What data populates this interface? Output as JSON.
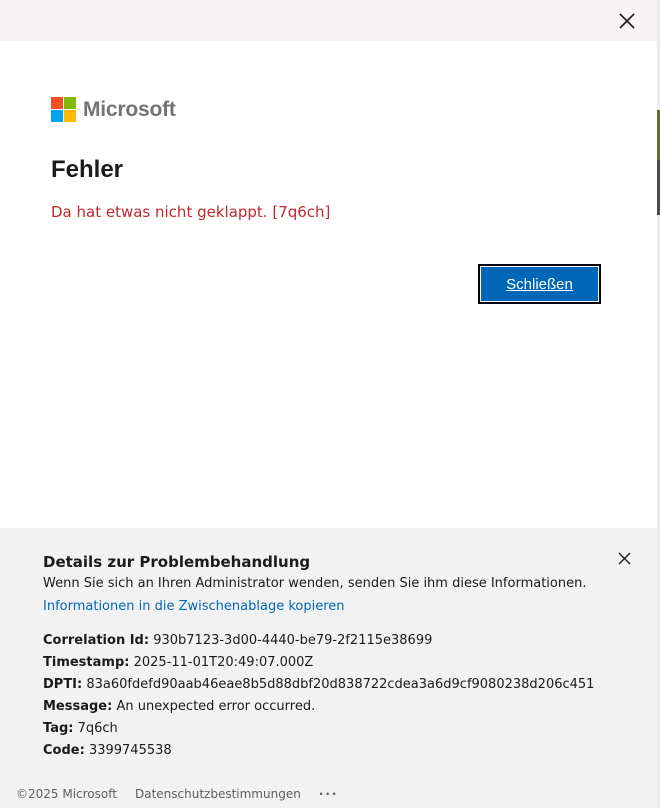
{
  "window": {
    "close_icon": "close-icon"
  },
  "logo": {
    "text": "Microsoft",
    "colors": [
      "#f25022",
      "#7fba00",
      "#00a4ef",
      "#ffb900"
    ]
  },
  "main": {
    "title": "Fehler",
    "error_message": "Da hat etwas nicht geklappt. [7q6ch]",
    "close_button_label": "Schließen"
  },
  "details": {
    "title": "Details zur Problembehandlung",
    "description": "Wenn Sie sich an Ihren Administrator wenden, senden Sie ihm diese Informationen.",
    "copy_link": "Informationen in die Zwischenablage kopieren",
    "fields": [
      {
        "key": "Correlation Id:",
        "value": "930b7123-3d00-4440-be79-2f2115e38699"
      },
      {
        "key": "Timestamp:",
        "value": "2025-11-01T20:49:07.000Z"
      },
      {
        "key": "DPTI:",
        "value": "83a60fdefd90aab46eae8b5d88dbf20d838722cdea3a6d9cf9080238d206c451"
      },
      {
        "key": "Message:",
        "value": "An unexpected error occurred."
      },
      {
        "key": "Tag:",
        "value": "7q6ch"
      },
      {
        "key": "Code:",
        "value": "3399745538"
      }
    ]
  },
  "footer": {
    "copyright": "©2025 Microsoft",
    "privacy": "Datenschutzbestimmungen",
    "more": "···"
  },
  "colors": {
    "accent": "#0067b8",
    "error": "#c4262e",
    "panel_bg": "#f2f2f2"
  }
}
